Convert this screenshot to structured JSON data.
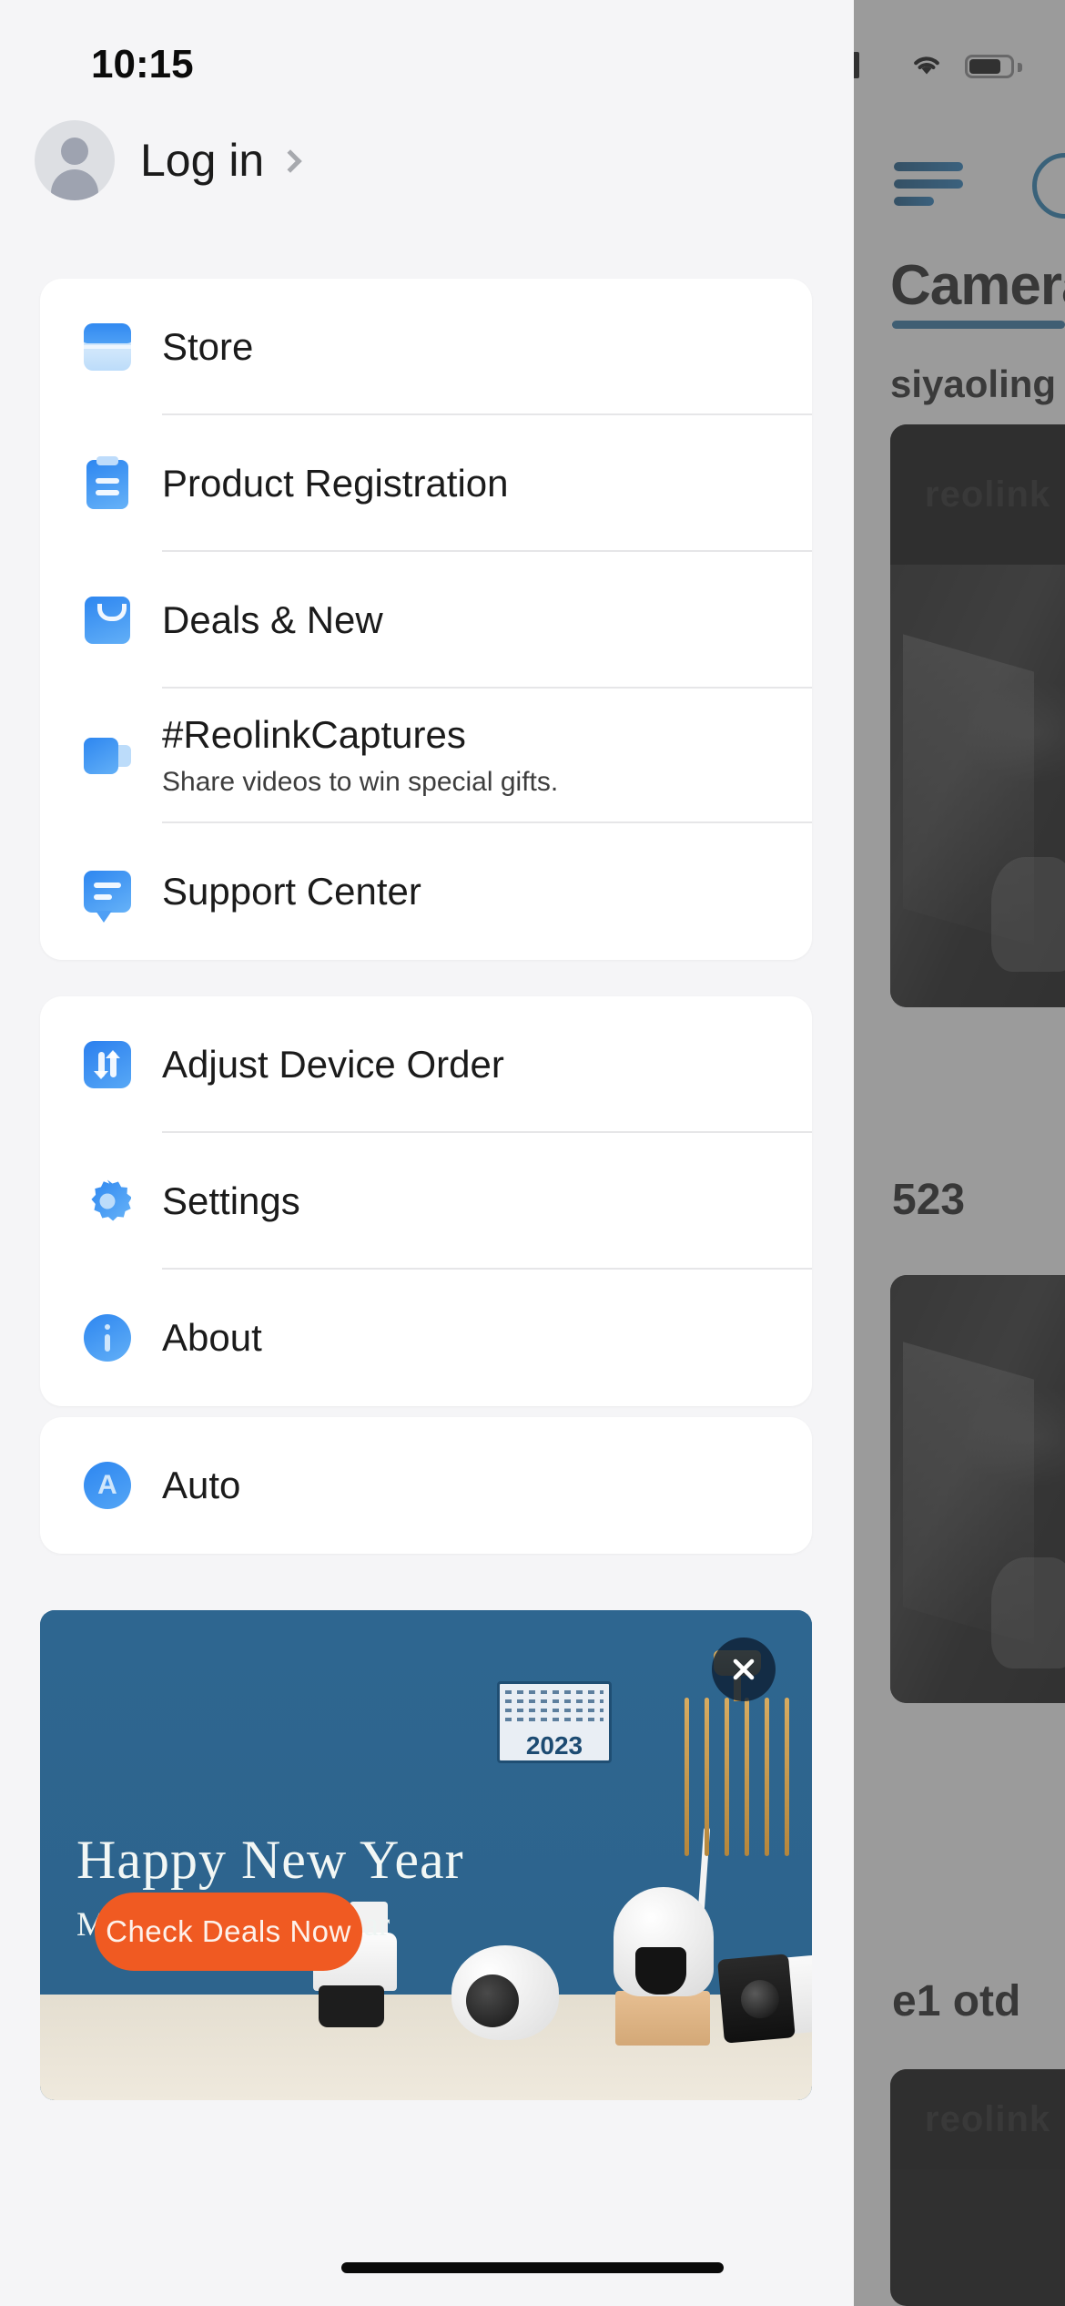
{
  "status_bar": {
    "time": "10:15",
    "icons": [
      "cellular-signal-icon",
      "wifi-icon",
      "battery-icon"
    ]
  },
  "account": {
    "label": "Log in",
    "avatar_icon": "person-avatar-icon",
    "chevron_icon": "chevron-right-icon"
  },
  "menu_groups": [
    {
      "items": [
        {
          "icon": "store-icon",
          "label": "Store",
          "subtitle": ""
        },
        {
          "icon": "clipboard-icon",
          "label": "Product Registration",
          "subtitle": ""
        },
        {
          "icon": "shopping-bag-icon",
          "label": "Deals & New",
          "subtitle": ""
        },
        {
          "icon": "video-camera-icon",
          "label": "#ReolinkCaptures",
          "subtitle": "Share videos to win special gifts."
        },
        {
          "icon": "chat-bubble-icon",
          "label": "Support Center",
          "subtitle": ""
        }
      ]
    },
    {
      "items": [
        {
          "icon": "sort-arrows-icon",
          "label": "Adjust Device Order",
          "subtitle": ""
        },
        {
          "icon": "gear-icon",
          "label": "Settings",
          "subtitle": ""
        },
        {
          "icon": "info-circle-icon",
          "label": "About",
          "subtitle": ""
        }
      ]
    },
    {
      "items": [
        {
          "icon": "auto-circle-icon",
          "label": "Auto",
          "subtitle": ""
        }
      ]
    }
  ],
  "banner": {
    "title": "Happy New Year",
    "subtitle": "Meet a Safer New Year",
    "cta_label": "Check Deals Now",
    "close_icon": "close-icon",
    "calendar_year": "2023",
    "background_color": "#2d648d",
    "cta_color": "#f05a22"
  },
  "background_app": {
    "menu_icon": "hamburger-menu-icon",
    "title": "Camera",
    "device_name": "siyaoling",
    "device_count": "523",
    "device_name_2": "e1 otd",
    "thumbnail_brand": "reolink",
    "accent_color": "#2a6f9e"
  },
  "home_indicator": "home-indicator"
}
